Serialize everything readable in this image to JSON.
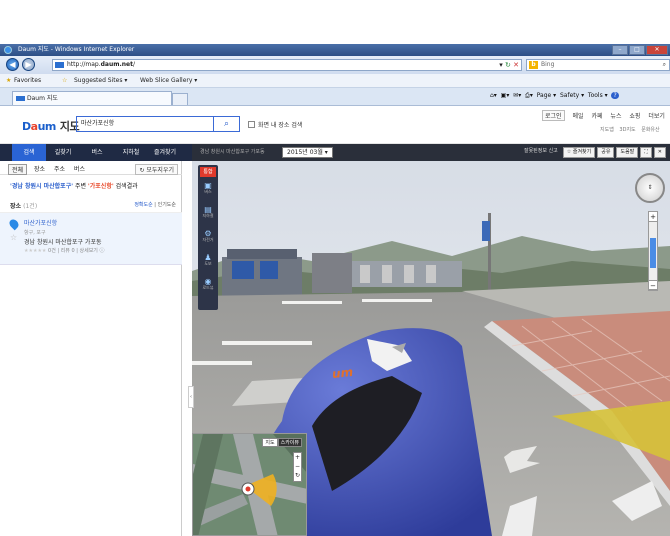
{
  "browser": {
    "title": "Daum 지도 - Windows Internet Explorer",
    "url_prefix": "http://map.",
    "url_host": "daum.net",
    "url_suffix": "/",
    "search_provider": "Bing",
    "favorites_label": "Favorites",
    "suggested_sites": "Suggested Sites ▾",
    "web_slice": "Web Slice Gallery ▾",
    "tab_title": "Daum 지도",
    "cmd": {
      "page": "Page ▾",
      "safety": "Safety ▾",
      "tools": "Tools ▾",
      "help": "?"
    }
  },
  "header": {
    "logo_d": "D",
    "logo_a": "a",
    "logo_um": "um",
    "logo_service": "지도",
    "search_value": "마산가포신항",
    "search_icon": "magnifier-icon",
    "checkbox_label": "화면 내 장소 검색",
    "top_links": [
      "로그인",
      "메일",
      "카페",
      "뉴스",
      "쇼핑",
      "더보기"
    ],
    "sub_links": [
      "지도앱",
      "3D지도",
      "문화유산"
    ]
  },
  "nav": {
    "tabs": [
      "검색",
      "길찾기",
      "버스",
      "지하철",
      "즐겨찾기"
    ],
    "active": "검색"
  },
  "roadview": {
    "location": "경남 창원시 마산합포구 가포동",
    "date": "2015년 03월 ▾",
    "actions": [
      "잘못된정보 신고",
      "☆ 즐겨찾기",
      "공유",
      "도움말",
      "⛶",
      "✕"
    ],
    "logo": "um",
    "side_buttons": [
      {
        "label": "통합"
      },
      {
        "icon": "bus-icon",
        "label": "버스"
      },
      {
        "icon": "subway-icon",
        "label": "지하철"
      },
      {
        "icon": "bicycle-icon",
        "label": "자전거"
      },
      {
        "icon": "walk-icon",
        "label": "도보"
      },
      {
        "icon": "location-icon",
        "label": "로드뷰"
      }
    ],
    "minimap_tabs": [
      "지도",
      "스카이뷰"
    ]
  },
  "results": {
    "filters": [
      "전체",
      "장소",
      "주소",
      "버스"
    ],
    "reset": "↻ 모두지우기",
    "summary_q": "'경남 창원시 마산합포구'",
    "summary_mid": " 주변 ",
    "summary_b": "'가포신항'",
    "summary_end": " 검색결과",
    "section": "장소",
    "section_count": "(1건)",
    "sort_a": "정확도순",
    "sort_b": "인기도순",
    "items": [
      {
        "name": "마산가포신항",
        "category": "항구, 포구",
        "address": "경남 창원시 마산합포구 가포동",
        "rating": "0건 | 리뷰 0 | 상세보기 ⓘ"
      }
    ]
  }
}
